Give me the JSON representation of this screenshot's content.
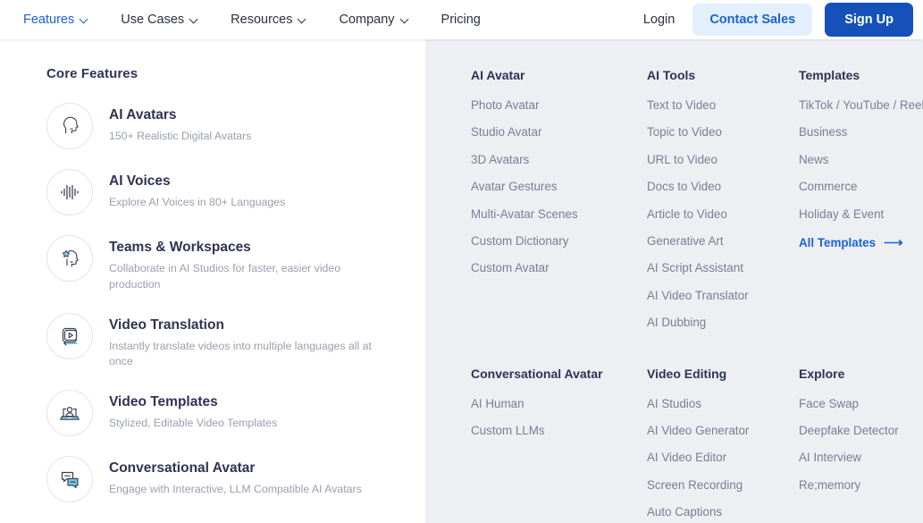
{
  "nav": {
    "items": [
      {
        "label": "Features",
        "icon": "chevron-down-icon",
        "active": true
      },
      {
        "label": "Use Cases",
        "icon": "chevron-down-icon",
        "active": false
      },
      {
        "label": "Resources",
        "icon": "chevron-down-icon",
        "active": false
      },
      {
        "label": "Company",
        "icon": "chevron-down-icon",
        "active": false
      },
      {
        "label": "Pricing",
        "icon": "",
        "active": false
      }
    ],
    "login_label": "Login",
    "contact_sales_label": "Contact Sales",
    "signup_label": "Sign Up"
  },
  "colors": {
    "accent_blue": "#1a62d6",
    "signup_blue": "#1551b8",
    "contact_bg": "#e4f0fd",
    "panel_bg": "#edeff3",
    "heading": "#2f3353",
    "link": "#787f95",
    "muted": "#9a9eae"
  },
  "core_features": {
    "title": "Core Features",
    "items": [
      {
        "icon": "head-profile-icon",
        "title": "AI Avatars",
        "desc": "150+ Realistic Digital Avatars"
      },
      {
        "icon": "audio-waveform-icon",
        "title": "AI Voices",
        "desc": "Explore AI Voices in 80+ Languages"
      },
      {
        "icon": "head-star-icon",
        "title": "Teams & Workspaces",
        "desc": "Collaborate in AI Studios for faster, easier video production"
      },
      {
        "icon": "video-translate-icon",
        "title": "Video Translation",
        "desc": "Instantly translate videos into multiple languages all at once"
      },
      {
        "icon": "laptop-person-icon",
        "title": "Video Templates",
        "desc": "Stylized, Editable Video Templates"
      },
      {
        "icon": "chat-bubbles-icon",
        "title": "Conversational Avatar",
        "desc": "Engage with Interactive, LLM Compatible AI Avatars"
      }
    ]
  },
  "link_columns": [
    {
      "title": "AI Avatar",
      "links": [
        {
          "label": "Photo Avatar"
        },
        {
          "label": "Studio Avatar"
        },
        {
          "label": "3D Avatars"
        },
        {
          "label": "Avatar Gestures"
        },
        {
          "label": "Multi-Avatar Scenes"
        },
        {
          "label": "Custom Dictionary"
        },
        {
          "label": "Custom Avatar"
        }
      ]
    },
    {
      "title": "AI Tools",
      "links": [
        {
          "label": "Text to Video"
        },
        {
          "label": "Topic to Video"
        },
        {
          "label": "URL to Video"
        },
        {
          "label": "Docs to Video"
        },
        {
          "label": "Article to Video"
        },
        {
          "label": "Generative Art"
        },
        {
          "label": "AI Script Assistant"
        },
        {
          "label": "AI Video Translator"
        },
        {
          "label": "AI Dubbing"
        }
      ]
    },
    {
      "title": "Templates",
      "links": [
        {
          "label": "TikTok / YouTube / Reels"
        },
        {
          "label": "Business"
        },
        {
          "label": "News"
        },
        {
          "label": "Commerce"
        },
        {
          "label": "Holiday & Event"
        },
        {
          "label": "All Templates",
          "accent": true,
          "arrow": "⟶"
        }
      ]
    },
    {
      "title": "Conversational Avatar",
      "links": [
        {
          "label": "AI Human"
        },
        {
          "label": "Custom LLMs"
        }
      ]
    },
    {
      "title": "Video Editing",
      "links": [
        {
          "label": "AI Studios"
        },
        {
          "label": "AI Video Generator"
        },
        {
          "label": "AI Video Editor"
        },
        {
          "label": "Screen Recording"
        },
        {
          "label": "Auto Captions"
        }
      ]
    },
    {
      "title": "Explore",
      "links": [
        {
          "label": "Face Swap"
        },
        {
          "label": "Deepfake Detector"
        },
        {
          "label": "AI Interview"
        },
        {
          "label": "Re;memory"
        }
      ]
    }
  ]
}
